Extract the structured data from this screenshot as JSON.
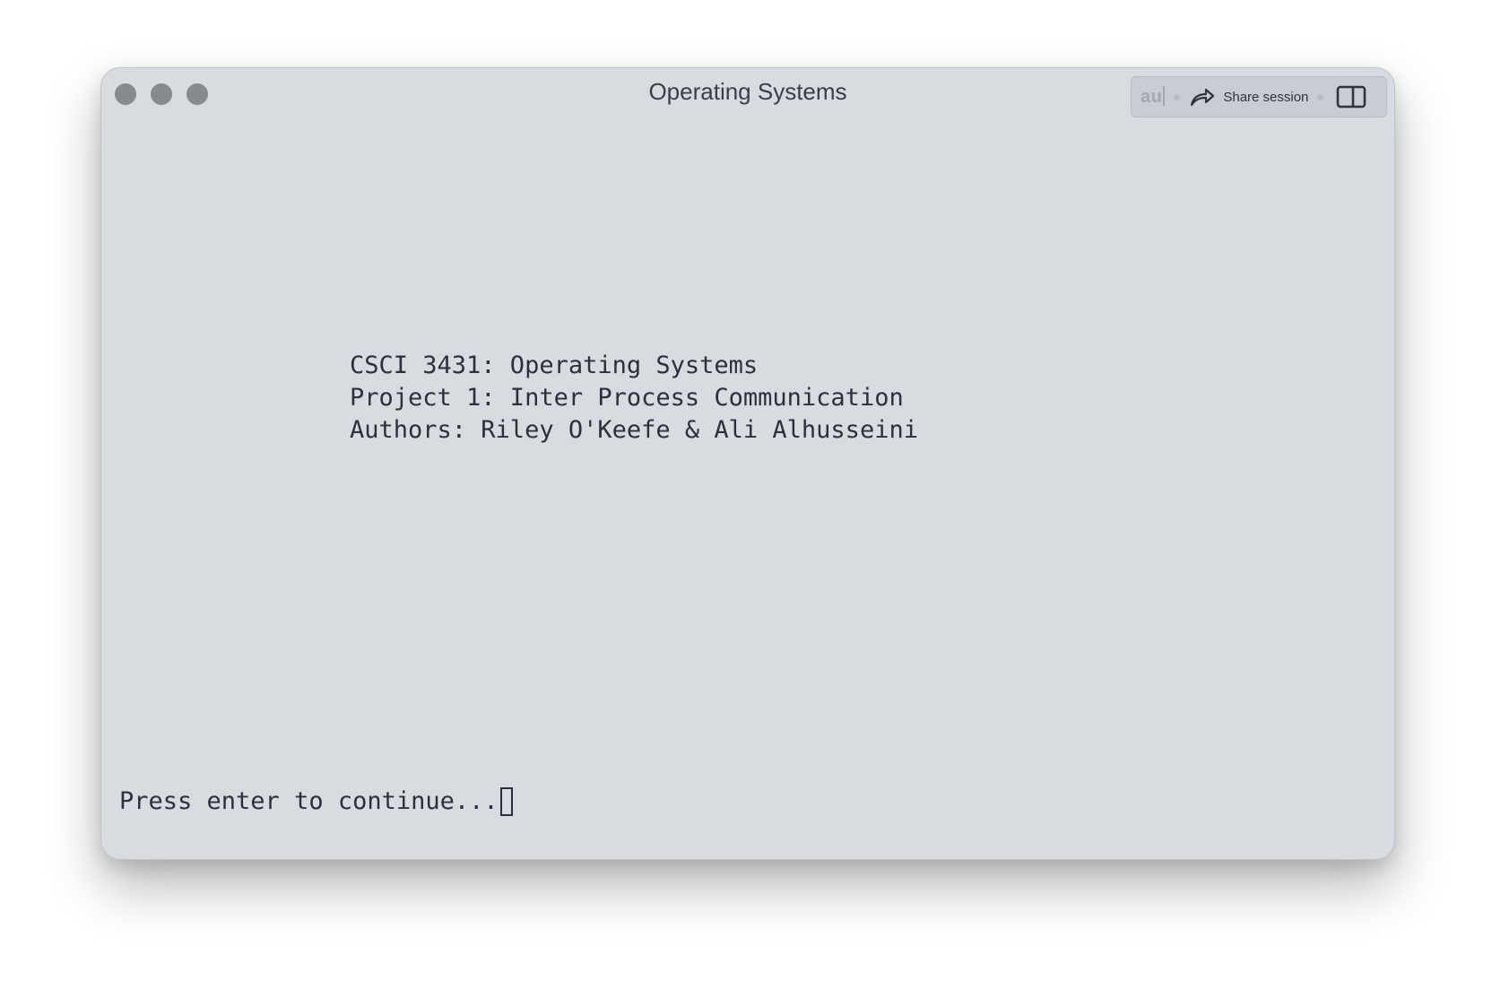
{
  "window": {
    "title": "Operating Systems"
  },
  "toolbar": {
    "input_text": "au",
    "share_label": "Share session",
    "share_icon": "share-arrow-icon",
    "panel_icon": "split-panel-icon"
  },
  "terminal": {
    "lines": [
      "CSCI 3431: Operating Systems",
      "Project 1: Inter Process Communication",
      "Authors: Riley O'Keefe & Ali Alhusseini"
    ],
    "prompt": "Press enter to continue..."
  },
  "colors": {
    "background": "#d8dce1",
    "text": "#2b303b",
    "traffic_light": "#888b8e"
  }
}
